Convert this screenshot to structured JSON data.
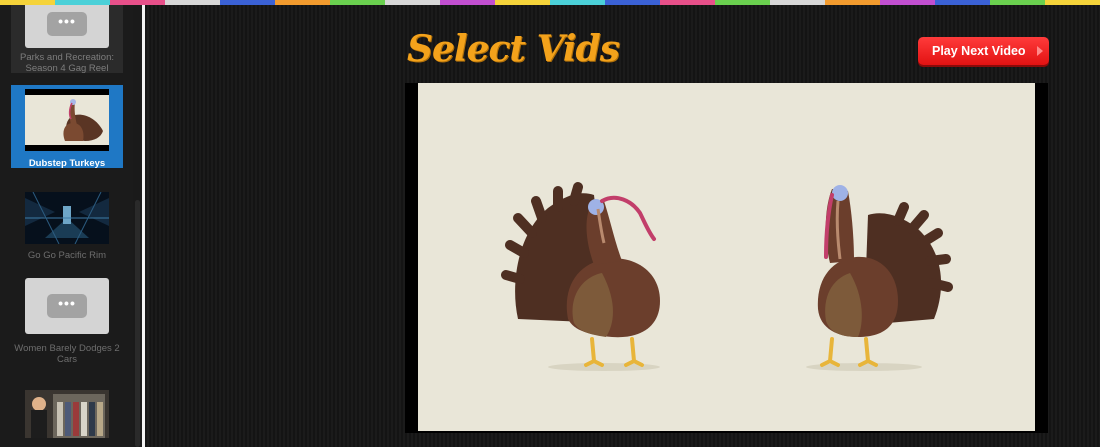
{
  "colors": {
    "strip": [
      "#f5d33a",
      "#4bd0d8",
      "#e8508a",
      "#d7d7d7",
      "#3b62d6",
      "#f29b2e",
      "#6ad04f",
      "#d7d7d7",
      "#c24fd0",
      "#f5d33a",
      "#4bd0d8",
      "#3b62d6",
      "#e8508a",
      "#6ad04f",
      "#d7d7d7",
      "#f29b2e",
      "#c24fd0",
      "#3b62d6",
      "#6ad04f",
      "#f5d33a"
    ],
    "accent": "#f3a21b",
    "play_button": "#f01a1a",
    "selected_item": "#1f78c5"
  },
  "sidebar": {
    "items": [
      {
        "label": "Parks and Recreation: Season 4 Gag Reel",
        "thumbnail": "placeholder-dots-icon"
      },
      {
        "label": "Dubstep Turkeys",
        "thumbnail": "turkey-thumbnail",
        "selected": true
      },
      {
        "label": "Go Go Pacific Rim",
        "thumbnail": "pacific-rim-thumbnail"
      },
      {
        "label": "Women Barely Dodges 2 Cars",
        "thumbnail": "placeholder-dots-icon"
      },
      {
        "label": "",
        "thumbnail": "closet-thumbnail"
      }
    ],
    "placeholder_glyph": "•••"
  },
  "header": {
    "brand": "Select Vids",
    "play_next_label": "Play Next Video"
  },
  "player": {
    "now_playing": "Dubstep Turkeys"
  }
}
